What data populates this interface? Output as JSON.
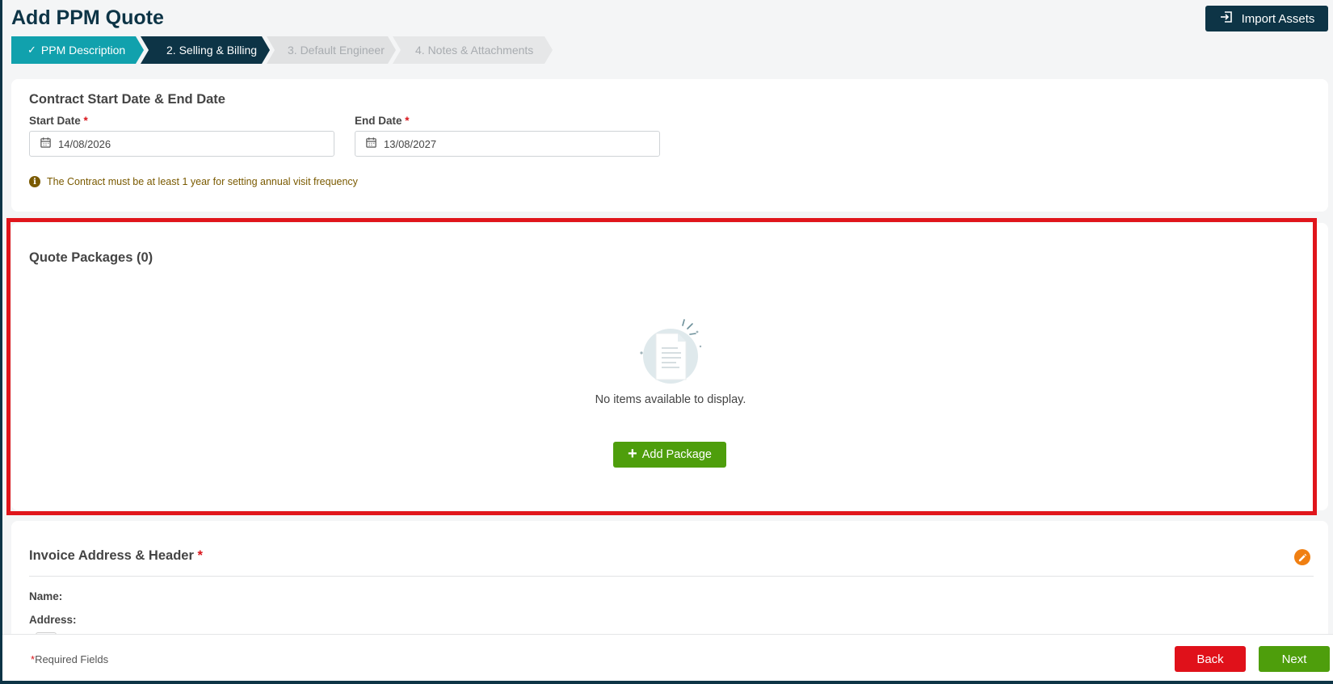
{
  "page": {
    "title": "Add PPM Quote"
  },
  "header": {
    "import_label": "Import Assets"
  },
  "steps": [
    {
      "label": "PPM Description",
      "state": "complete"
    },
    {
      "label": "2. Selling & Billing",
      "state": "active"
    },
    {
      "label": "3. Default Engineer",
      "state": "upcoming"
    },
    {
      "label": "4. Notes & Attachments",
      "state": "upcoming"
    }
  ],
  "contract": {
    "title": "Contract Start Date & End Date",
    "start_label": "Start Date",
    "start_value": "14/08/2026",
    "end_label": "End Date",
    "end_value": "13/08/2027",
    "required_mark": "*",
    "info": "The Contract must be at least 1 year for setting annual visit frequency"
  },
  "packages": {
    "title": "Quote Packages (0)",
    "empty_text": "No items available to display.",
    "add_label": "Add Package"
  },
  "invoice": {
    "title": "Invoice Address & Header",
    "required_mark": "*",
    "name_label": "Name:",
    "address_label": "Address:"
  },
  "footer": {
    "required_mark": "*",
    "required_text": "Required Fields",
    "back_label": "Back",
    "next_label": "Next"
  },
  "colors": {
    "primary": "#0d3446",
    "teal": "#11a1ad",
    "green": "#4e9e0c",
    "red": "#e0111a",
    "orange": "#f07f12",
    "highlight": "#e0151b"
  },
  "icons": [
    "import-icon",
    "check-icon",
    "calendar-icon",
    "info-icon",
    "empty-document-icon",
    "plus-icon",
    "pencil-icon"
  ]
}
